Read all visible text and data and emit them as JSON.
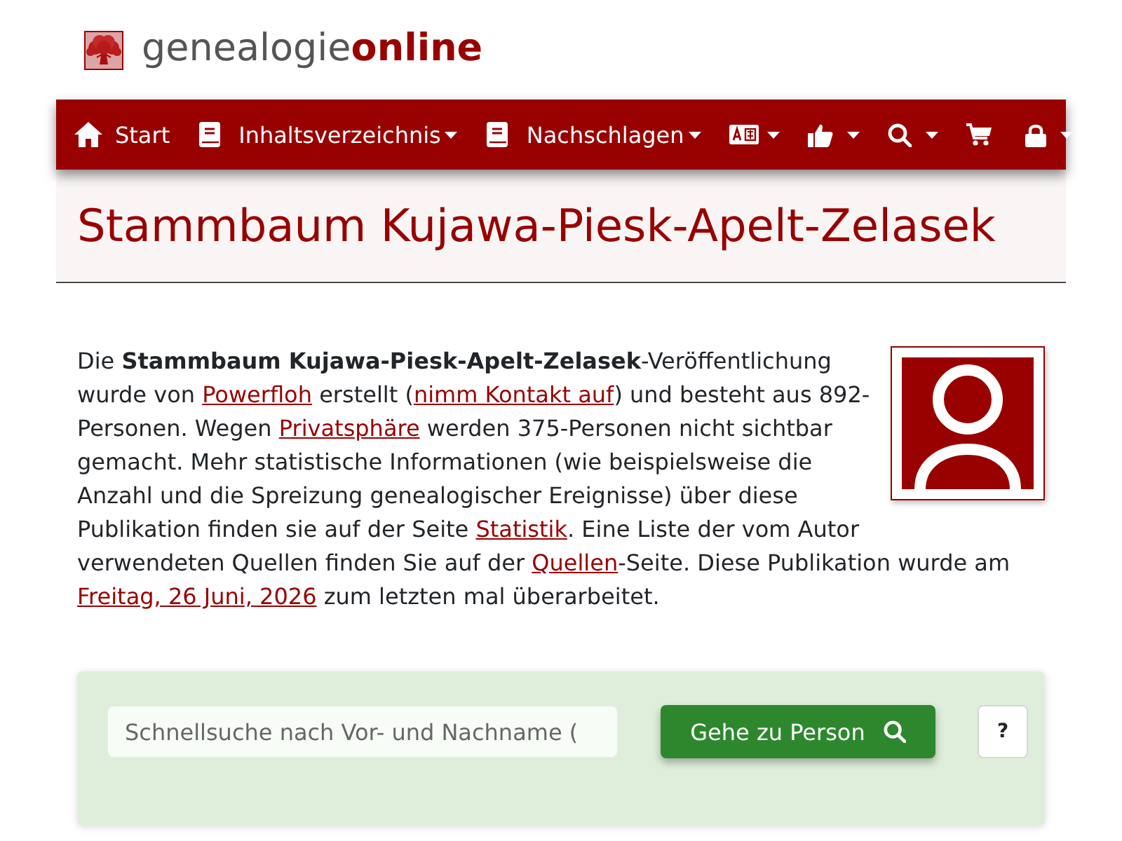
{
  "brand": {
    "name_light": "genealogie",
    "name_bold": "online"
  },
  "navbar": {
    "items": [
      {
        "kind": "home",
        "label": "Start",
        "dropdown": false
      },
      {
        "kind": "book",
        "label": "Inhaltsverzeichnis",
        "dropdown": true
      },
      {
        "kind": "book",
        "label": "Nachschlagen",
        "dropdown": true
      },
      {
        "kind": "language",
        "dropdown": true
      },
      {
        "kind": "thumbs",
        "dropdown": true
      },
      {
        "kind": "search",
        "dropdown": true
      },
      {
        "kind": "cart",
        "dropdown": false
      },
      {
        "kind": "lock",
        "dropdown": true
      }
    ]
  },
  "page_title": "Stammbaum Kujawa-Piesk-Apelt-Zelasek",
  "intro": {
    "blocks": [
      {
        "parts": [
          {
            "kind": "text",
            "text": "Die **Stammbaum Kujawa-Piesk-Apelt-Zelasek**-Veröffentlichung wurde von "
          },
          {
            "kind": "link",
            "text": "Powerfloh"
          },
          {
            "kind": "text",
            "text": " erstellt ("
          },
          {
            "kind": "link",
            "text": "nimm Kontakt auf"
          },
          {
            "kind": "text",
            "text": ") und besteht aus 892-Personen. Wegen "
          },
          {
            "kind": "link",
            "text": "Privatsphäre"
          },
          {
            "kind": "text",
            "text": " werden 375-Personen nicht sichtbar gemacht. Mehr statistische Informationen (wie beispielsweise die Anzahl und die Spreizung genealogischer Ereignisse) über diese Publikation finden sie auf der Seite "
          },
          {
            "kind": "link",
            "text": "Statistik"
          },
          {
            "kind": "text",
            "text": ". Eine Liste der vom Autor"
          }
        ]
      },
      {
        "parts": [
          {
            "kind": "text",
            "text": "verwendeten Quellen finden Sie auf der "
          },
          {
            "kind": "link",
            "text": "Quellen"
          },
          {
            "kind": "text",
            "text": "-Seite. Diese Publikation wurde am "
          },
          {
            "kind": "link",
            "text": "Freitag, 26 Juni, 2026"
          },
          {
            "kind": "text",
            "text": " zum letzten mal überarbeitet."
          }
        ]
      }
    ]
  },
  "search": {
    "placeholder": "Schnellsuche nach Vor- und Nachname (",
    "button": "Gehe zu Person",
    "help": "?"
  }
}
